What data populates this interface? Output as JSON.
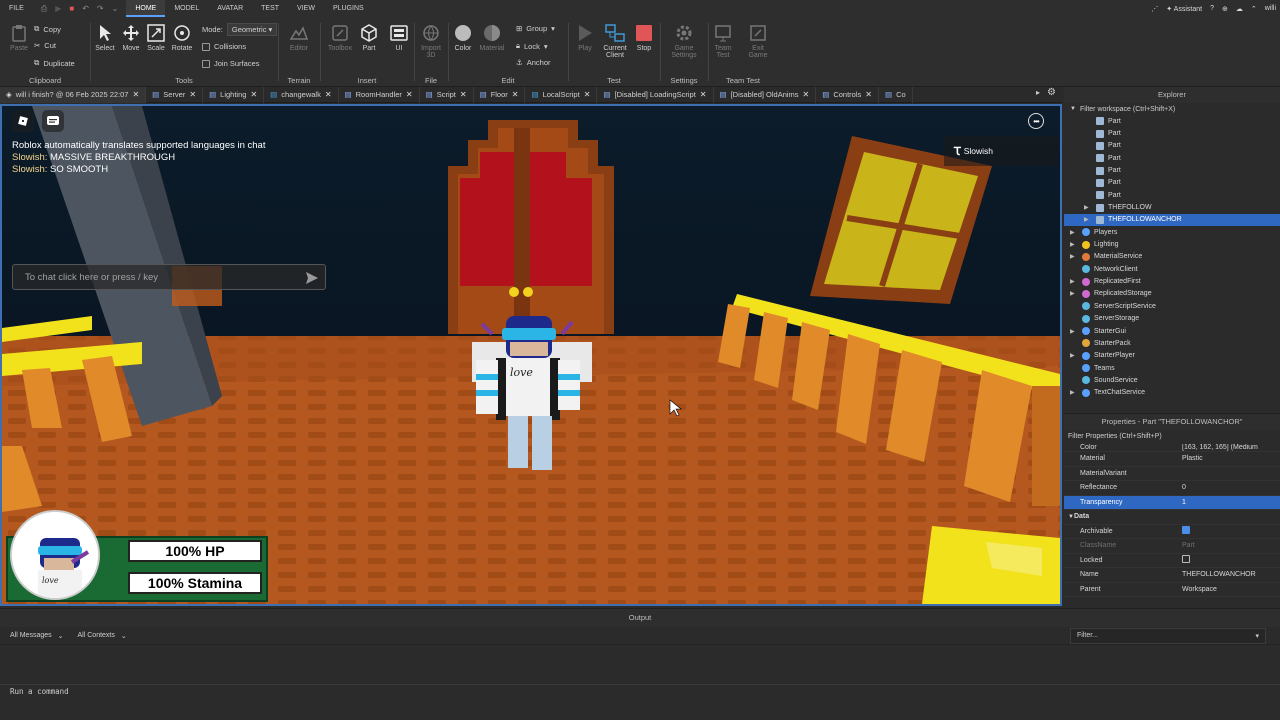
{
  "menu": {
    "items": [
      "FILE",
      "HOME",
      "MODEL",
      "AVATAR",
      "TEST",
      "VIEW",
      "PLUGINS"
    ],
    "active": "HOME",
    "assistant": "Assistant",
    "user": "willi"
  },
  "ribbon": {
    "clipboard": {
      "paste": "Paste",
      "copy": "Copy",
      "cut": "Cut",
      "duplicate": "Duplicate",
      "label": "Clipboard"
    },
    "tools": {
      "select": "Select",
      "move": "Move",
      "scale": "Scale",
      "rotate": "Rotate",
      "mode_label": "Mode:",
      "mode_value": "Geometric",
      "collisions": "Collisions",
      "join_surfaces": "Join Surfaces",
      "label": "Tools"
    },
    "terrain": {
      "editor": "Editor",
      "label": "Terrain"
    },
    "insert": {
      "toolbox": "Toolbox",
      "part": "Part",
      "ui": "UI",
      "label": "Insert"
    },
    "file": {
      "import3d_1": "Import",
      "import3d_2": "3D",
      "label": "File"
    },
    "edit": {
      "color": "Color",
      "material": "Material",
      "group": "Group",
      "lock": "Lock",
      "anchor": "Anchor",
      "label": "Edit"
    },
    "test": {
      "play": "Play",
      "current_client_1": "Current",
      "current_client_2": "Client",
      "stop": "Stop",
      "label": "Test"
    },
    "settings": {
      "game_settings_1": "Game",
      "game_settings_2": "Settings",
      "label": "Settings"
    },
    "team_test": {
      "team_test_1": "Team",
      "team_test_2": "Test",
      "exit_game_1": "Exit",
      "exit_game_2": "Game",
      "label": "Team Test"
    }
  },
  "tabs": [
    {
      "label": "will i finish? @ 06 Feb 2025 22:07",
      "icon": "roblox-icon"
    },
    {
      "label": "Server",
      "icon": "script-icon"
    },
    {
      "label": "Lighting",
      "icon": "script-icon"
    },
    {
      "label": "changewalk",
      "icon": "localscript-icon"
    },
    {
      "label": "RoomHandler",
      "icon": "script-icon"
    },
    {
      "label": "Script",
      "icon": "script-icon"
    },
    {
      "label": "Floor",
      "icon": "script-icon"
    },
    {
      "label": "LocalScript",
      "icon": "localscript-icon"
    },
    {
      "label": "[Disabled] LoadingScript",
      "icon": "script-icon"
    },
    {
      "label": "[Disabled] OldAnims",
      "icon": "script-icon"
    },
    {
      "label": "Controls",
      "icon": "script-icon"
    },
    {
      "label": "Co",
      "icon": "script-icon"
    }
  ],
  "viewport": {
    "chat_messages": [
      {
        "name": "",
        "text": "Roblox automatically translates supported languages in chat"
      },
      {
        "name": "Slowish:",
        "text": " MASSIVE BREAKTHROUGH"
      },
      {
        "name": "Slowish:",
        "text": " SO SMOOTH"
      }
    ],
    "chat_placeholder": "To chat click here or press / key",
    "player_name": "Slowish",
    "hp": "100% HP",
    "stamina": "100% Stamina",
    "shirt_text": "love"
  },
  "explorer": {
    "title": "Explorer",
    "filter": "Filter workspace (Ctrl+Shift+X)",
    "tree": [
      {
        "label": "Part",
        "indent": 3,
        "icon": "part",
        "arrow": false
      },
      {
        "label": "Part",
        "indent": 3,
        "icon": "part",
        "arrow": false
      },
      {
        "label": "Part",
        "indent": 3,
        "icon": "part",
        "arrow": false
      },
      {
        "label": "Part",
        "indent": 3,
        "icon": "part",
        "arrow": false
      },
      {
        "label": "Part",
        "indent": 3,
        "icon": "part",
        "arrow": false
      },
      {
        "label": "Part",
        "indent": 3,
        "icon": "part",
        "arrow": false
      },
      {
        "label": "Part",
        "indent": 3,
        "icon": "part",
        "arrow": false
      },
      {
        "label": "THEFOLLOW",
        "indent": 3,
        "icon": "part",
        "arrow": true
      },
      {
        "label": "THEFOLLOWANCHOR",
        "indent": 3,
        "icon": "part",
        "arrow": true,
        "selected": true
      },
      {
        "label": "Players",
        "indent": 2,
        "icon": "players",
        "arrow": true
      },
      {
        "label": "Lighting",
        "indent": 2,
        "icon": "lighting",
        "arrow": true
      },
      {
        "label": "MaterialService",
        "indent": 2,
        "icon": "material",
        "arrow": true
      },
      {
        "label": "NetworkClient",
        "indent": 2,
        "icon": "network",
        "arrow": false
      },
      {
        "label": "ReplicatedFirst",
        "indent": 2,
        "icon": "replicated",
        "arrow": true
      },
      {
        "label": "ReplicatedStorage",
        "indent": 2,
        "icon": "replicated",
        "arrow": true
      },
      {
        "label": "ServerScriptService",
        "indent": 2,
        "icon": "server",
        "arrow": false
      },
      {
        "label": "ServerStorage",
        "indent": 2,
        "icon": "server",
        "arrow": false
      },
      {
        "label": "StarterGui",
        "indent": 2,
        "icon": "startergui",
        "arrow": true
      },
      {
        "label": "StarterPack",
        "indent": 2,
        "icon": "starterpack",
        "arrow": false
      },
      {
        "label": "StarterPlayer",
        "indent": 2,
        "icon": "starterplayer",
        "arrow": true
      },
      {
        "label": "Teams",
        "indent": 2,
        "icon": "teams",
        "arrow": false
      },
      {
        "label": "SoundService",
        "indent": 2,
        "icon": "sound",
        "arrow": false
      },
      {
        "label": "TextChatService",
        "indent": 2,
        "icon": "textchat",
        "arrow": true
      }
    ]
  },
  "properties": {
    "title": "Properties - Part \"THEFOLLOWANCHOR\"",
    "filter": "Filter Properties (Ctrl+Shift+P)",
    "rows": [
      {
        "name": "Color",
        "value": "[163, 162, 165] (Medium",
        "kind": "cut"
      },
      {
        "name": "Material",
        "value": "Plastic"
      },
      {
        "name": "MaterialVariant",
        "value": ""
      },
      {
        "name": "Reflectance",
        "value": "0"
      },
      {
        "name": "Transparency",
        "value": "1",
        "kind": "selected"
      },
      {
        "name": "Data",
        "value": "",
        "kind": "category"
      },
      {
        "name": "Archivable",
        "value": "",
        "kind": "checkbox-on"
      },
      {
        "name": "ClassName",
        "value": "Part",
        "kind": "dim"
      },
      {
        "name": "Locked",
        "value": "",
        "kind": "checkbox-off"
      },
      {
        "name": "Name",
        "value": "THEFOLLOWANCHOR"
      },
      {
        "name": "Parent",
        "value": "Workspace"
      }
    ]
  },
  "output": {
    "title": "Output",
    "messages_filter": "All Messages",
    "contexts_filter": "All Contexts",
    "filter_placeholder": "Filter...",
    "command_placeholder": "Run a command"
  },
  "colors": {
    "accent": "#2f68c3",
    "viewport_border": "#3e6fb0",
    "stop_red": "#e05555",
    "hud_green": "#1a6b33"
  }
}
